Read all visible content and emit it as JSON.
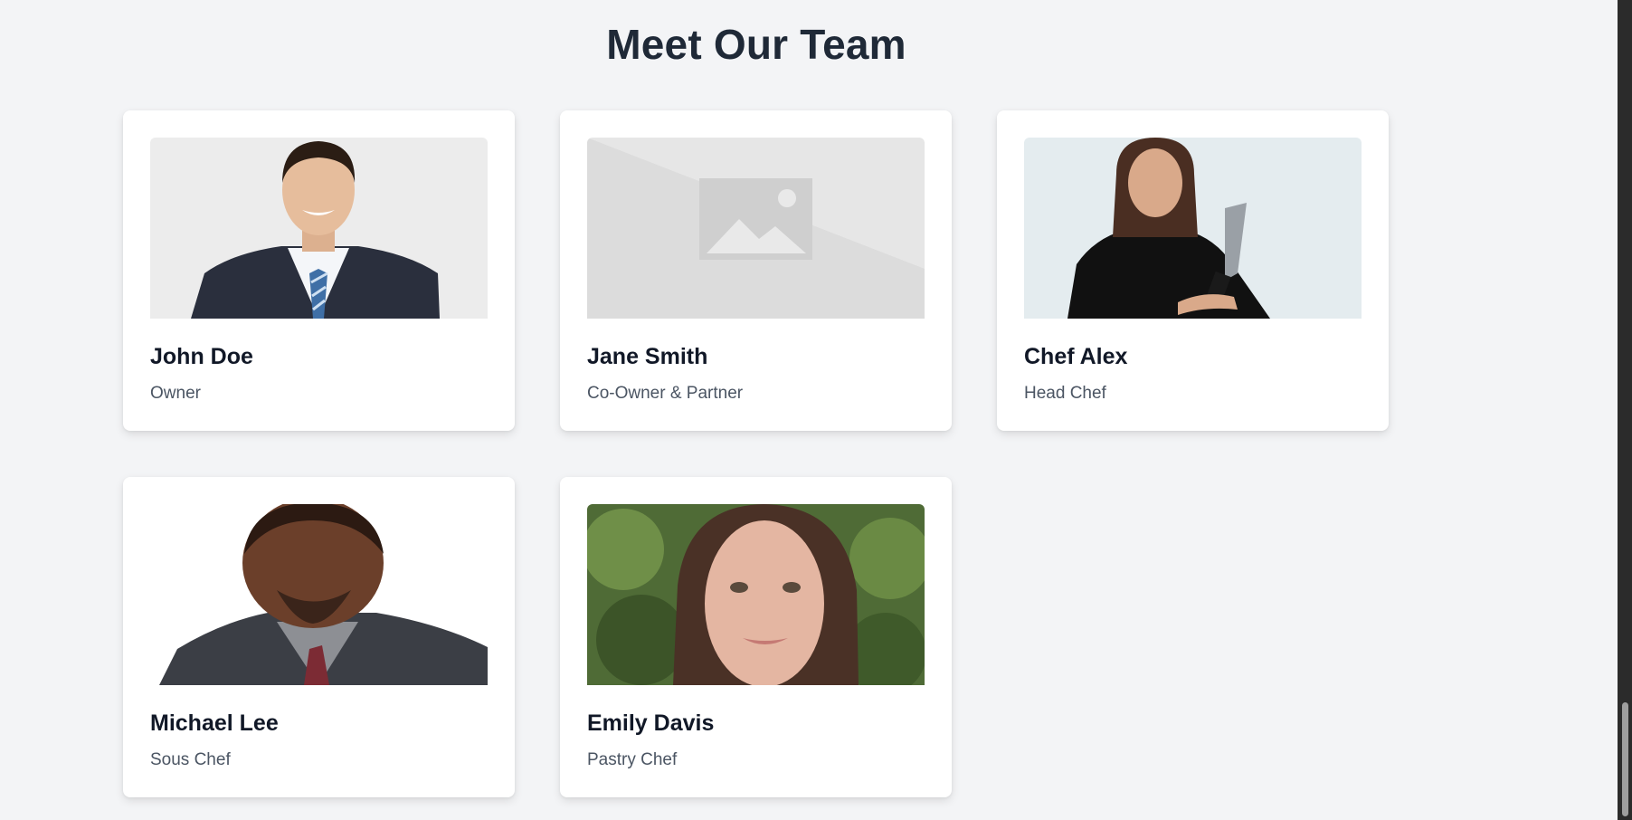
{
  "section": {
    "title": "Meet Our Team"
  },
  "team": [
    {
      "name": "John Doe",
      "role": "Owner"
    },
    {
      "name": "Jane Smith",
      "role": "Co-Owner & Partner"
    },
    {
      "name": "Chef Alex",
      "role": "Head Chef"
    },
    {
      "name": "Michael Lee",
      "role": "Sous Chef"
    },
    {
      "name": "Emily Davis",
      "role": "Pastry Chef"
    }
  ]
}
